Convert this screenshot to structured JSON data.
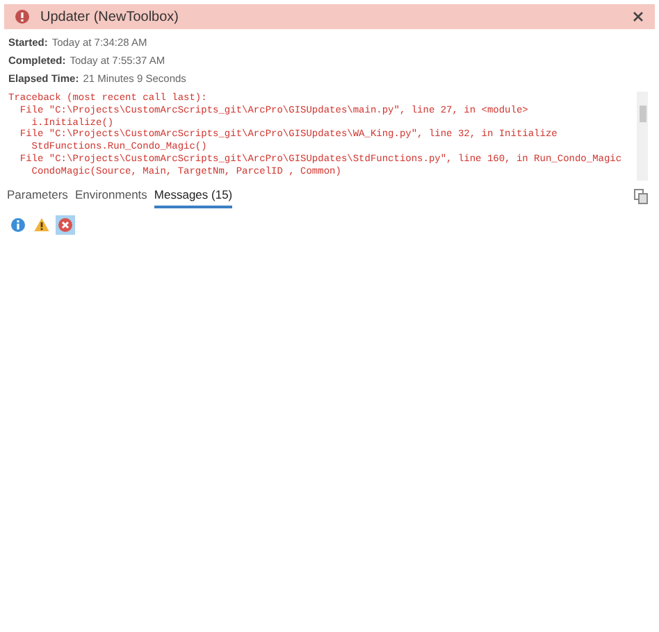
{
  "window": {
    "title": "Updater (NewToolbox)"
  },
  "details": [
    {
      "label": "Started:",
      "value": "Today at 7:34:28 AM"
    },
    {
      "label": "Completed:",
      "value": "Today at 7:55:37 AM"
    },
    {
      "label": "Elapsed Time:",
      "value": "21 Minutes 9 Seconds"
    }
  ],
  "traceback": [
    "Traceback (most recent call last):",
    "  File \"C:\\Projects\\CustomArcScripts_git\\ArcPro\\GISUpdates\\main.py\", line 27, in <module>",
    "    i.Initialize()",
    "  File \"C:\\Projects\\CustomArcScripts_git\\ArcPro\\GISUpdates\\WA_King.py\", line 32, in Initialize",
    "    StdFunctions.Run_Condo_Magic()",
    "  File \"C:\\Projects\\CustomArcScripts_git\\ArcPro\\GISUpdates\\StdFunctions.py\", line 160, in Run_Condo_Magic",
    "    CondoMagic(Source, Main, TargetNm, ParcelID , Common)"
  ],
  "tabs": [
    {
      "label": "Parameters",
      "selected": false
    },
    {
      "label": "Environments",
      "selected": false
    },
    {
      "label": "Messages (15)",
      "selected": true
    }
  ],
  "filters": [
    {
      "kind": "info",
      "selected": false
    },
    {
      "kind": "warning",
      "selected": false
    },
    {
      "kind": "error",
      "selected": true
    }
  ]
}
